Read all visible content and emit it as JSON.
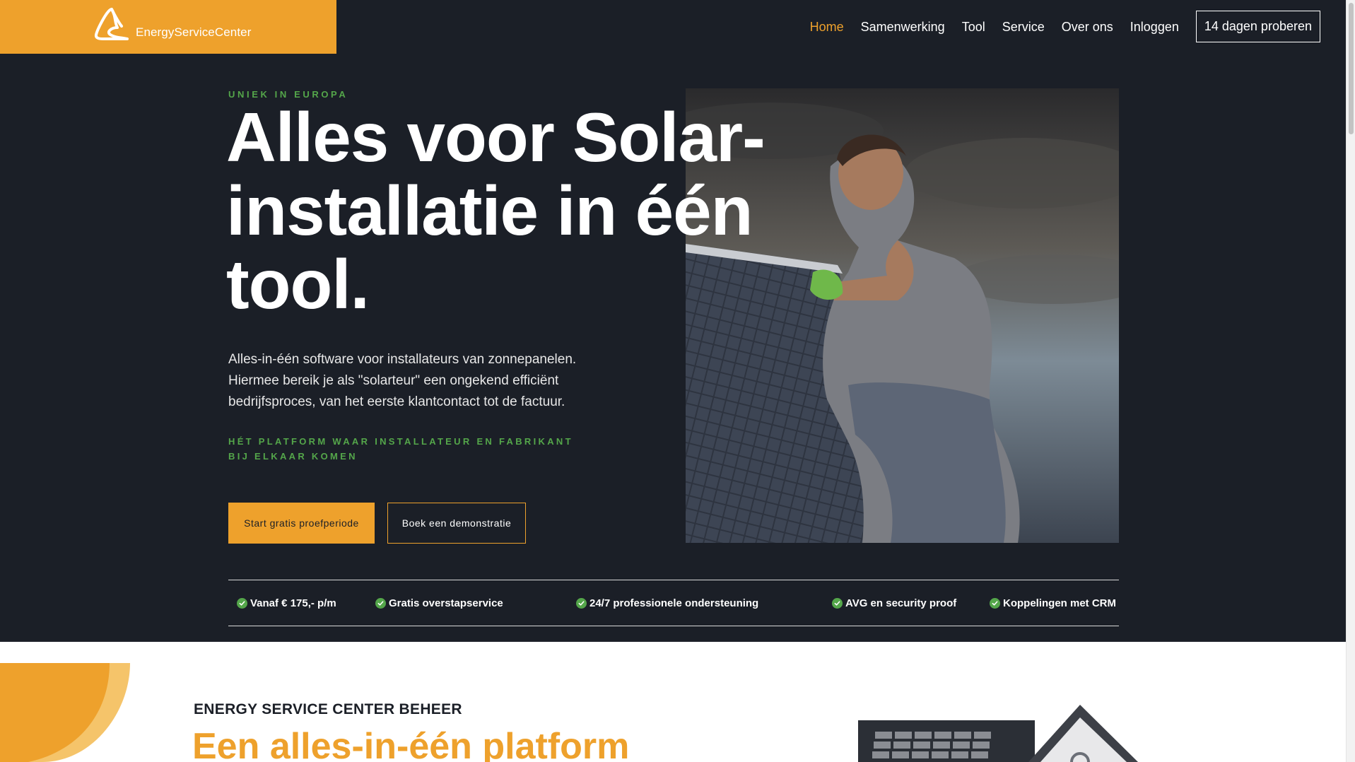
{
  "header": {
    "logo_text": "EnergyServiceCenter",
    "nav": [
      {
        "label": "Home",
        "active": true
      },
      {
        "label": "Samenwerking"
      },
      {
        "label": "Tool"
      },
      {
        "label": "Service"
      },
      {
        "label": "Over ons"
      },
      {
        "label": "Inloggen"
      }
    ],
    "cta_label": "14 dagen proberen"
  },
  "hero": {
    "eyebrow": "UNIEK IN EUROPA",
    "title": "Alles voor Solar-installatie in één tool.",
    "description": "Alles-in-één software voor installateurs van zonnepanelen. Hiermee bereik je als \"solarteur\" een ongekend efficiënt bedrijfsproces, van het eerste klantcontact tot de factuur.",
    "tagline": "HÉT PLATFORM WAAR INSTALLATEUR EN FABRIKANT BIJ ELKAAR KOMEN",
    "primary_button": "Start gratis proefperiode",
    "secondary_button": "Boek een demonstratie",
    "image_icon": "solar-installer-photo"
  },
  "features": [
    {
      "label": "Vanaf € 175,- p/m"
    },
    {
      "label": "Gratis overstapservice"
    },
    {
      "label": "24/7 professionele ondersteuning"
    },
    {
      "label": "AVG en security proof"
    },
    {
      "label": "Koppelingen met CRM"
    }
  ],
  "section": {
    "eyebrow": "ENERGY SERVICE CENTER BEHEER",
    "title": "Een alles-in-één platform"
  },
  "colors": {
    "accent": "#eea12c",
    "dark_bg": "#1b1f27",
    "green": "#54a64a"
  }
}
